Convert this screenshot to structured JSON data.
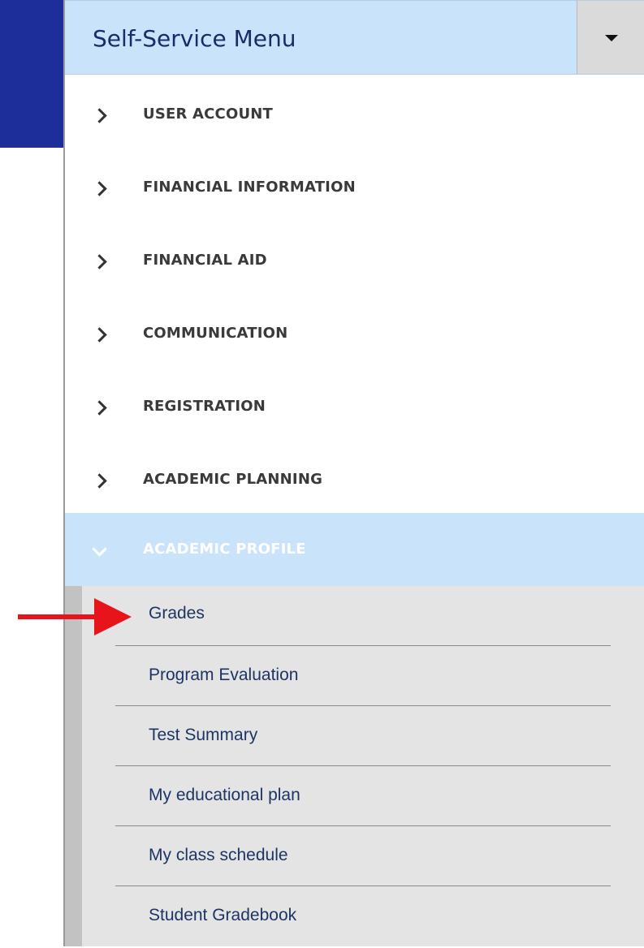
{
  "menu": {
    "title": "Self-Service Menu",
    "toggle_icon": "caret-down-icon"
  },
  "sections": [
    {
      "label": "USER ACCOUNT",
      "expanded": false
    },
    {
      "label": "FINANCIAL INFORMATION",
      "expanded": false
    },
    {
      "label": "FINANCIAL AID",
      "expanded": false
    },
    {
      "label": "COMMUNICATION",
      "expanded": false
    },
    {
      "label": "REGISTRATION",
      "expanded": false
    },
    {
      "label": "ACADEMIC PLANNING",
      "expanded": false
    },
    {
      "label": "ACADEMIC PROFILE",
      "expanded": true
    }
  ],
  "academic_profile_items": [
    {
      "label": "Grades"
    },
    {
      "label": "Program Evaluation"
    },
    {
      "label": "Test Summary"
    },
    {
      "label": "My educational plan"
    },
    {
      "label": "My class schedule"
    },
    {
      "label": "Student Gradebook"
    }
  ],
  "colors": {
    "header_band": "#1d2e9b",
    "menu_header_bg": "#c9e4fa",
    "active_section_bg": "#c9e4fa",
    "submenu_bg": "#e4e4e4",
    "annotation_arrow": "#e8141b"
  },
  "annotation": {
    "icon": "red-arrow-icon",
    "points_to": "Grades"
  }
}
